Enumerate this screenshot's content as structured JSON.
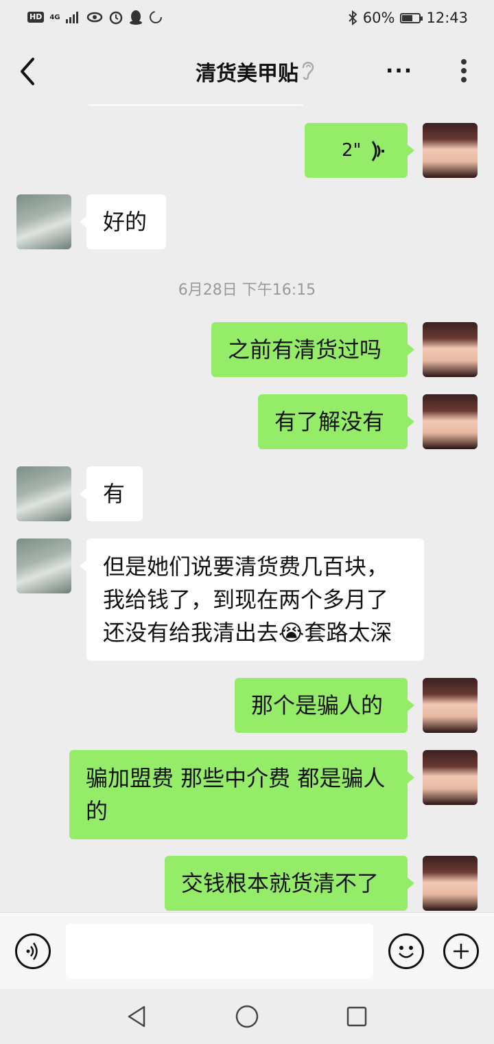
{
  "status_bar": {
    "hd_badge": "HD",
    "network": "4G",
    "battery": "60%",
    "battery_level": 0.6,
    "time": "12:43"
  },
  "header": {
    "title": "清货美甲贴",
    "more_label": "···"
  },
  "messages": [
    {
      "side": "me",
      "type": "voice",
      "duration": "2\""
    },
    {
      "side": "peer",
      "text": "好的"
    },
    {
      "side": "timestamp",
      "text": "6月28日 下午16:15"
    },
    {
      "side": "me",
      "text": "之前有清货过吗"
    },
    {
      "side": "me",
      "text": "有了解没有"
    },
    {
      "side": "peer",
      "text": "有"
    },
    {
      "side": "peer",
      "lines": [
        "但是她们说要清货费几百块，",
        "我给钱了，到现在两个多月了",
        "还没有给我清出去😭套路太深"
      ]
    },
    {
      "side": "me",
      "text": "那个是骗人的"
    },
    {
      "side": "me",
      "lines": [
        "骗加盟费 那些中介费 都是骗人",
        "的"
      ]
    },
    {
      "side": "me",
      "text": "交钱根本就货清不了"
    }
  ],
  "input": {
    "placeholder": ""
  },
  "icons": {
    "back": "chevron-left-icon",
    "ear": "ear-icon",
    "voice": "voice-input-icon",
    "emoji": "emoji-icon",
    "plus": "add-icon",
    "nav_back": "triangle-back-icon",
    "nav_home": "circle-home-icon",
    "nav_recent": "square-recent-icon"
  }
}
